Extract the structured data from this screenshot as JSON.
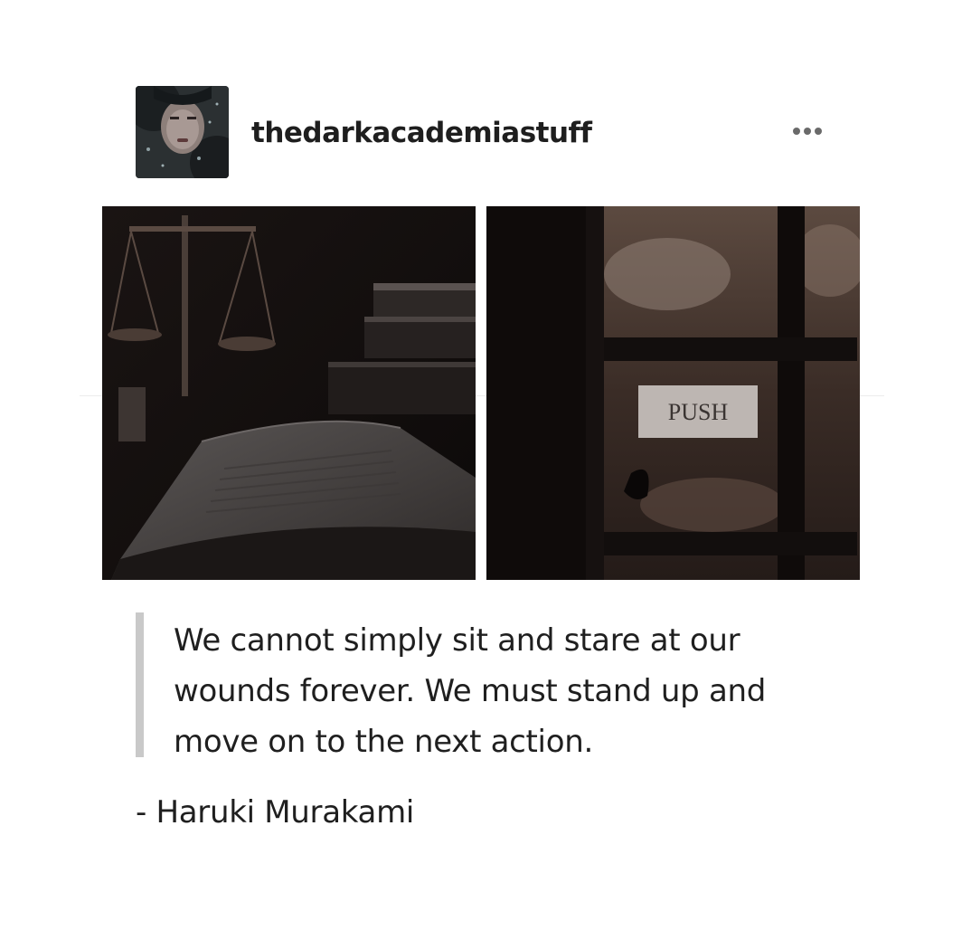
{
  "post": {
    "username": "thedarkacademiastuff",
    "avatar_icon": "profile-avatar",
    "more_icon": "ellipsis-icon",
    "photos": [
      {
        "icon": "scales-and-open-book-photo"
      },
      {
        "icon": "door-push-sign-photo",
        "sign_text": "PUSH"
      }
    ],
    "quote": {
      "lines": [
        "We cannot simply sit and stare at our",
        "wounds forever. We must stand up and",
        "move on to the next action."
      ]
    },
    "attribution": "- Haruki Murakami"
  },
  "colors": {
    "text": "#1f1f1f",
    "quote_bar": "#c9c9c9",
    "ellipsis": "#6a6a6a"
  }
}
